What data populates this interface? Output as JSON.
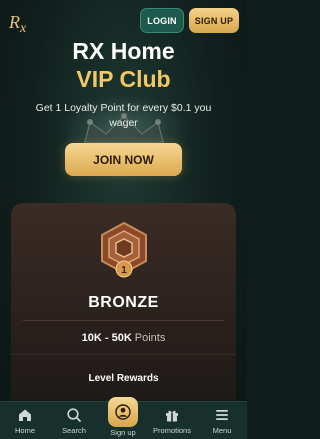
{
  "header": {
    "logo_text": "RX",
    "login_label": "LOGIN",
    "signup_label": "SIGN UP"
  },
  "hero": {
    "title": "RX Home",
    "subtitle": "VIP Club",
    "description": "Get 1 Loyalty Point for every $0.1 you wager",
    "join_label": "JOIN NOW"
  },
  "tier": {
    "badge_level": "1",
    "name": "BRONZE",
    "points_range": "10K - 50K",
    "points_unit": "Points",
    "rewards_title": "Level Rewards"
  },
  "bottom_nav": {
    "items": [
      {
        "label": "Home",
        "icon": "home-icon"
      },
      {
        "label": "Search",
        "icon": "search-icon"
      },
      {
        "label": "Sign up",
        "icon": "user-icon"
      },
      {
        "label": "Promotions",
        "icon": "gift-icon"
      },
      {
        "label": "Menu",
        "icon": "menu-icon"
      }
    ]
  },
  "colors": {
    "accent_gold": "#f1c768",
    "login_green": "#1d5a4c",
    "background": "#11201d",
    "bronze_card": "#3b2b25"
  }
}
